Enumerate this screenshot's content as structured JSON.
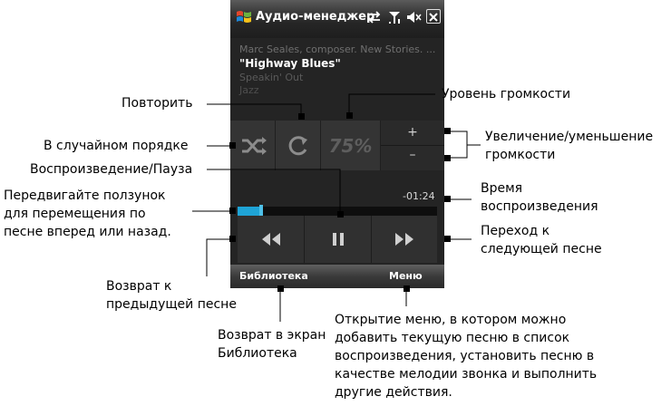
{
  "app": {
    "title": "Аудио-менеджер"
  },
  "now_playing": {
    "artist": "Marc Seales, composer. New Stories. ...",
    "title": "\"Highway Blues\"",
    "album": "Speakin' Out",
    "genre": "Jazz"
  },
  "controls": {
    "shuffle": "shuffle-icon",
    "repeat": "repeat-icon",
    "volume_level": "75%",
    "volume_up": "+",
    "volume_down": "–"
  },
  "playback": {
    "time_remaining": "-01:24",
    "progress": 0.12
  },
  "transport": {
    "previous": "rewind-icon",
    "play_pause": "pause-icon",
    "next": "fast-forward-icon"
  },
  "softkeys": {
    "left": "Библиотека",
    "right": "Меню"
  },
  "callouts": {
    "repeat": "Повторить",
    "volume_level": "Уровень громкости",
    "shuffle": "В случайном порядке",
    "volume_change": [
      "Увеличение/уменьшение",
      "громкости"
    ],
    "play_pause": "Воспроизведение/Пауза",
    "seek": [
      "Передвигайте ползунок",
      "для перемещения по",
      "песне вперед или назад."
    ],
    "playback_time": [
      "Время",
      "воспроизведения"
    ],
    "next_song": [
      "Переход к",
      "следующей песне"
    ],
    "prev_song": [
      "Возврат к",
      "предыдущей песне"
    ],
    "library": [
      "Возврат в экран",
      "Библиотека"
    ],
    "menu": [
      "Открытие меню, в котором можно",
      "добавить текущую песню в список",
      "воспроизведения, установить песню в",
      "качестве мелодии звонка и выполнить",
      "другие действия."
    ]
  },
  "colors": {
    "accent": "#1fa4d6",
    "screen_bg": "#242424",
    "label_text": "#000000"
  }
}
